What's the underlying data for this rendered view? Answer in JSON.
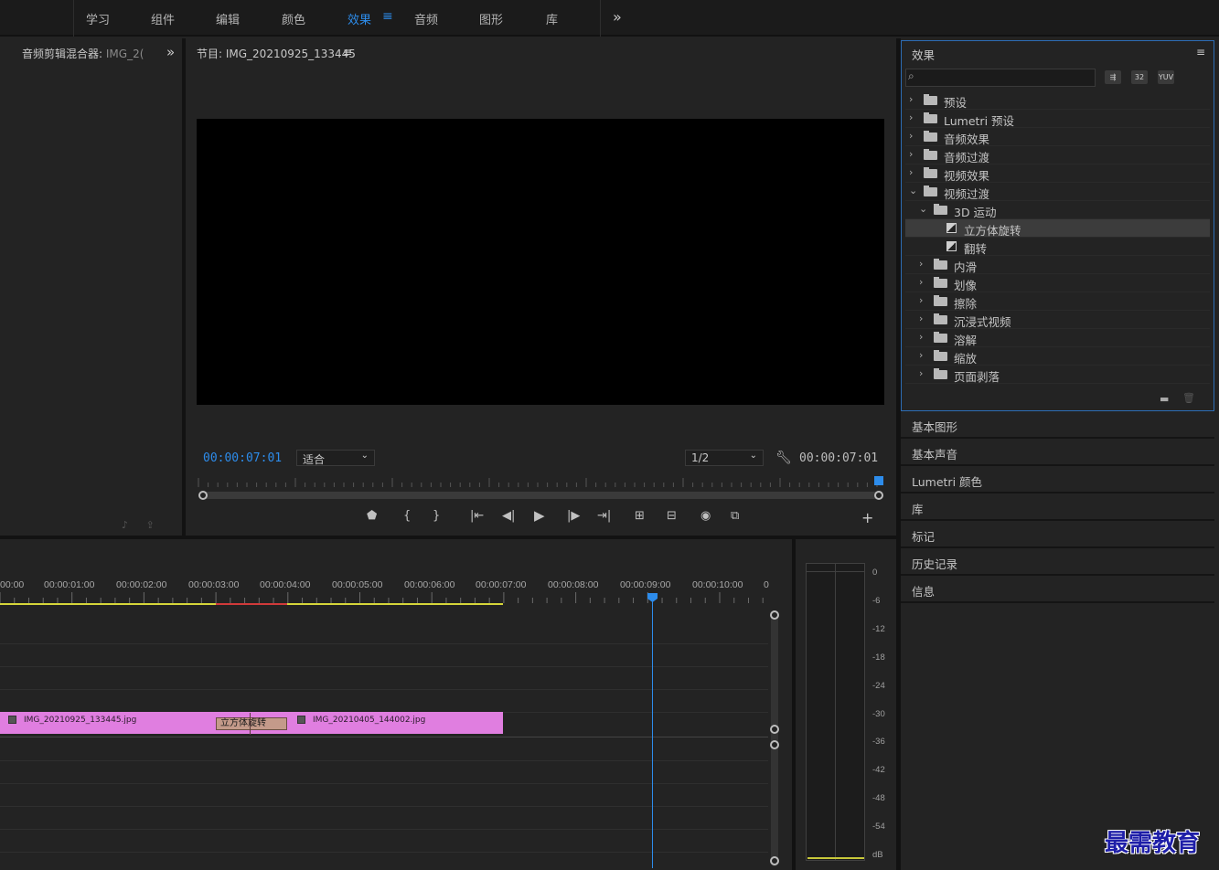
{
  "workspaces": {
    "tabs": [
      {
        "label": "学习"
      },
      {
        "label": "组件"
      },
      {
        "label": "编辑"
      },
      {
        "label": "颜色"
      },
      {
        "label": "效果"
      },
      {
        "label": "音频"
      },
      {
        "label": "图形"
      },
      {
        "label": "库"
      }
    ],
    "active": "效果",
    "accent_color": "#2d8ceb"
  },
  "mixer": {
    "title": "音频剪辑混合器:",
    "clip": "IMG_2("
  },
  "program": {
    "title": "节目: IMG_20210925_133445",
    "timecode_current": "00:00:07:01",
    "timecode_duration": "00:00:07:01",
    "fit": "适合",
    "resolution": "1/2"
  },
  "timeline": {
    "ruler_labels": [
      "00:00",
      "00:00:01:00",
      "00:00:02:00",
      "00:00:03:00",
      "00:00:04:00",
      "00:00:05:00",
      "00:00:06:00",
      "00:00:07:00",
      "00:00:08:00",
      "00:00:09:00",
      "00:00:10:00",
      "0"
    ],
    "clips": [
      {
        "name": "IMG_20210925_133445.jpg",
        "color": "#e07ee0"
      },
      {
        "name": "IMG_20210405_144002.jpg",
        "color": "#e07ee0"
      }
    ],
    "transition": "立方体旋转"
  },
  "meter": {
    "db_labels": [
      "0",
      "-6",
      "-12",
      "-18",
      "-24",
      "-30",
      "-36",
      "-42",
      "-48",
      "-54",
      "dB"
    ]
  },
  "effects": {
    "title": "效果",
    "search_value": "",
    "filter_buttons": [
      "accelerated-effects",
      "32-bit",
      "yuv"
    ],
    "tree": [
      {
        "label": "预设",
        "level": 0,
        "expanded": false,
        "kind": "preset-bin"
      },
      {
        "label": "Lumetri 预设",
        "level": 0,
        "expanded": false,
        "kind": "preset-bin"
      },
      {
        "label": "音频效果",
        "level": 0,
        "expanded": false,
        "kind": "bin"
      },
      {
        "label": "音频过渡",
        "level": 0,
        "expanded": false,
        "kind": "bin"
      },
      {
        "label": "视频效果",
        "level": 0,
        "expanded": false,
        "kind": "bin"
      },
      {
        "label": "视频过渡",
        "level": 0,
        "expanded": true,
        "kind": "bin"
      },
      {
        "label": "3D 运动",
        "level": 1,
        "expanded": true,
        "kind": "bin"
      },
      {
        "label": "立方体旋转",
        "level": 2,
        "kind": "effect",
        "selected": true
      },
      {
        "label": "翻转",
        "level": 2,
        "kind": "effect"
      },
      {
        "label": "内滑",
        "level": 1,
        "expanded": false,
        "kind": "bin"
      },
      {
        "label": "划像",
        "level": 1,
        "expanded": false,
        "kind": "bin"
      },
      {
        "label": "擦除",
        "level": 1,
        "expanded": false,
        "kind": "bin"
      },
      {
        "label": "沉浸式视频",
        "level": 1,
        "expanded": false,
        "kind": "bin"
      },
      {
        "label": "溶解",
        "level": 1,
        "expanded": false,
        "kind": "bin"
      },
      {
        "label": "缩放",
        "level": 1,
        "expanded": false,
        "kind": "bin"
      },
      {
        "label": "页面剥落",
        "level": 1,
        "expanded": false,
        "kind": "bin"
      }
    ]
  },
  "collapsed_panels": [
    {
      "label": "基本图形"
    },
    {
      "label": "基本声音"
    },
    {
      "label": "Lumetri 颜色"
    },
    {
      "label": "库"
    },
    {
      "label": "标记"
    },
    {
      "label": "历史记录"
    },
    {
      "label": "信息"
    }
  ],
  "watermark": "最需教育"
}
